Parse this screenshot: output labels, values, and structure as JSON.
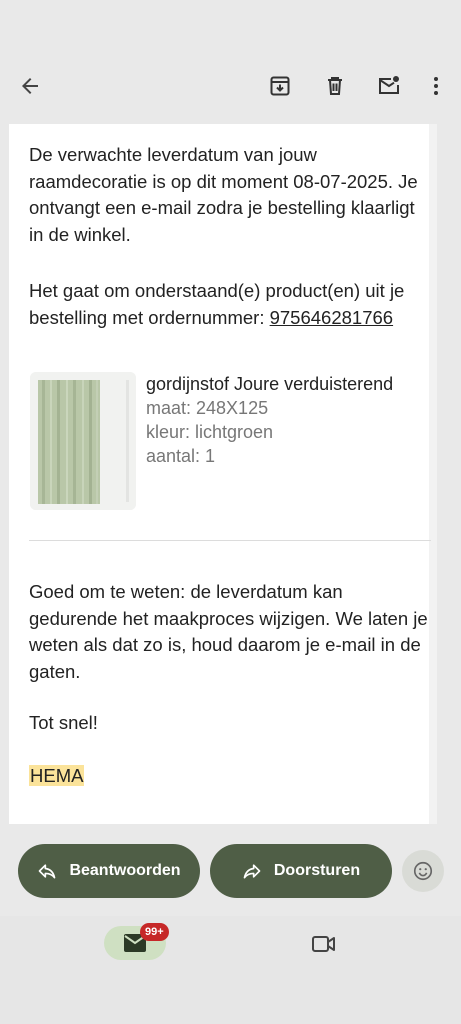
{
  "toolbar": {
    "back_icon": "arrow-back-icon",
    "archive_icon": "archive-icon",
    "delete_icon": "trash-icon",
    "mark_unread_icon": "mail-unread-icon",
    "more_icon": "more-vert-icon"
  },
  "email": {
    "para1": "De verwachte leverdatum van jouw raamdecoratie is op dit moment 08-07-2025. Je ontvangt een e-mail zodra je bestelling klaarligt in de winkel.",
    "para2_prefix": "Het gaat om onderstaand(e) product(en) uit je bestelling met ordernummer: ",
    "order_number": "975646281766",
    "product": {
      "name": "gordijnstof Joure verduisterend",
      "size": "maat: 248X125",
      "color": "kleur: lichtgroen",
      "quantity": "aantal: 1"
    },
    "para3": "Goed om te weten: de leverdatum kan gedurende het maakproces wijzigen. We laten je weten als dat zo is, houd daarom je e-mail in de gaten.",
    "closing": "Tot snel!",
    "signature": "HEMA"
  },
  "actions": {
    "reply_label": "Beantwoorden",
    "forward_label": "Doorsturen"
  },
  "bottom_nav": {
    "mail_badge": "99+"
  },
  "colors": {
    "action_button": "#4f5e46",
    "badge": "#c62828",
    "highlight": "#fbe39a"
  }
}
